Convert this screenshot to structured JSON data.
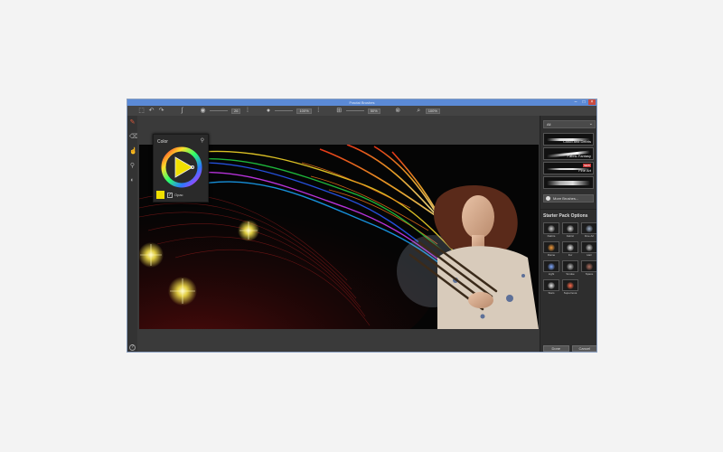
{
  "window": {
    "title": "Fractal Brushes"
  },
  "toolbar": {
    "size_value": "26",
    "opacity_value": "100%",
    "flow_value": "50%",
    "zoom_value": "100%"
  },
  "color_popup": {
    "title": "Color",
    "swatch_color": "#f1e000",
    "opacity_label": "Opac"
  },
  "right_panel": {
    "brush_category": "All",
    "brushes": [
      {
        "name": "Cloud and Debris"
      },
      {
        "name": "Fabric Fantasy"
      },
      {
        "name": "Fine Art",
        "badge": "NEW"
      }
    ],
    "more_brushes_label": "More Brushes...",
    "section_title": "Starter Pack Options",
    "presets": [
      {
        "name": "Debris",
        "color": "#cfcfcf"
      },
      {
        "name": "Fabric",
        "color": "#d8d8d8"
      },
      {
        "name": "Fine Art",
        "color": "#9fb0c8"
      },
      {
        "name": "Flame",
        "color": "#f39a3a"
      },
      {
        "name": "Fur",
        "color": "#e8e8e8"
      },
      {
        "name": "Hair",
        "color": "#c8c8c8"
      },
      {
        "name": "Light",
        "color": "#7fa8ff"
      },
      {
        "name": "Smoke",
        "color": "#bcbcbc"
      },
      {
        "name": "Space",
        "color": "#b07060"
      },
      {
        "name": "Stars",
        "color": "#e6e6e6"
      },
      {
        "name": "Supernova",
        "color": "#ff6a4a"
      }
    ],
    "ok_label": "Done",
    "cancel_label": "Cancel"
  }
}
